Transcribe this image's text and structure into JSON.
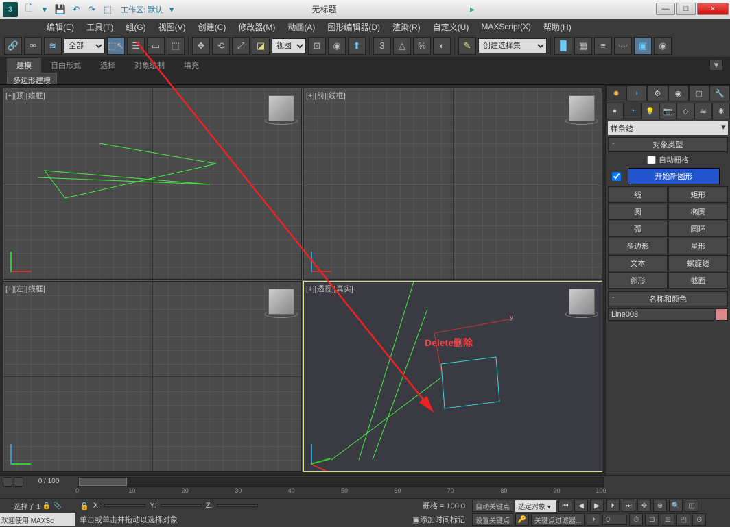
{
  "titlebar": {
    "workspace_label": "工作区: 默认",
    "title": "无标题",
    "min": "—",
    "max": "□",
    "close": "×"
  },
  "menu": {
    "edit": "编辑(E)",
    "tools": "工具(T)",
    "group": "组(G)",
    "views": "视图(V)",
    "create": "创建(C)",
    "modifiers": "修改器(M)",
    "animation": "动画(A)",
    "grapheditors": "图形编辑器(D)",
    "rendering": "渲染(R)",
    "customize": "自定义(U)",
    "maxscript": "MAXScript(X)",
    "help": "帮助(H)"
  },
  "toolbar": {
    "filter_all": "全部",
    "view_label": "视图",
    "named_sel_set": "创建选择集"
  },
  "ribbon": {
    "modeling": "建模",
    "freeform": "自由形式",
    "selection": "选择",
    "objectpaint": "对象绘制",
    "populate": "填充",
    "polymod": "多边形建模"
  },
  "viewports": {
    "top": "[+][顶][线框]",
    "front": "[+][前][线框]",
    "left": "[+][左][线框]",
    "persp": "[+][透视][真实]"
  },
  "cmdpanel": {
    "spline_dd": "样条线",
    "obj_type": "对象类型",
    "autogrid": "自动栅格",
    "start_new": "开始新图形",
    "line": "线",
    "rectangle": "矩形",
    "circle": "圆",
    "ellipse": "椭圆",
    "arc": "弧",
    "donut": "圆环",
    "ngon": "多边形",
    "star": "星形",
    "text": "文本",
    "helix": "螺旋线",
    "egg": "卵形",
    "section": "截面",
    "name_color": "名称和颜色",
    "obj_name": "Line003"
  },
  "timeline": {
    "frame_label": "0 / 100"
  },
  "ruler": {
    "t0": "0",
    "t10": "10",
    "t20": "20",
    "t30": "30",
    "t40": "40",
    "t50": "50",
    "t60": "60",
    "t70": "70",
    "t80": "80",
    "t90": "90",
    "t100": "100"
  },
  "status": {
    "sel_count": "选择了 1",
    "welcome": "欢迎使用 MAXSc",
    "x_lbl": "X:",
    "y_lbl": "Y:",
    "z_lbl": "Z:",
    "grid_lbl": "栅格 = 100.0",
    "autokey": "自动关键点",
    "setkey": "设置关键点",
    "sel_obj": "选定对象",
    "keyfilter": "关键点过滤器...",
    "prompt": "单击或单击并拖动以选择对象",
    "addtime": "添加时间标记",
    "framefld": "0"
  },
  "annotation": {
    "delete": "Delete删除"
  }
}
